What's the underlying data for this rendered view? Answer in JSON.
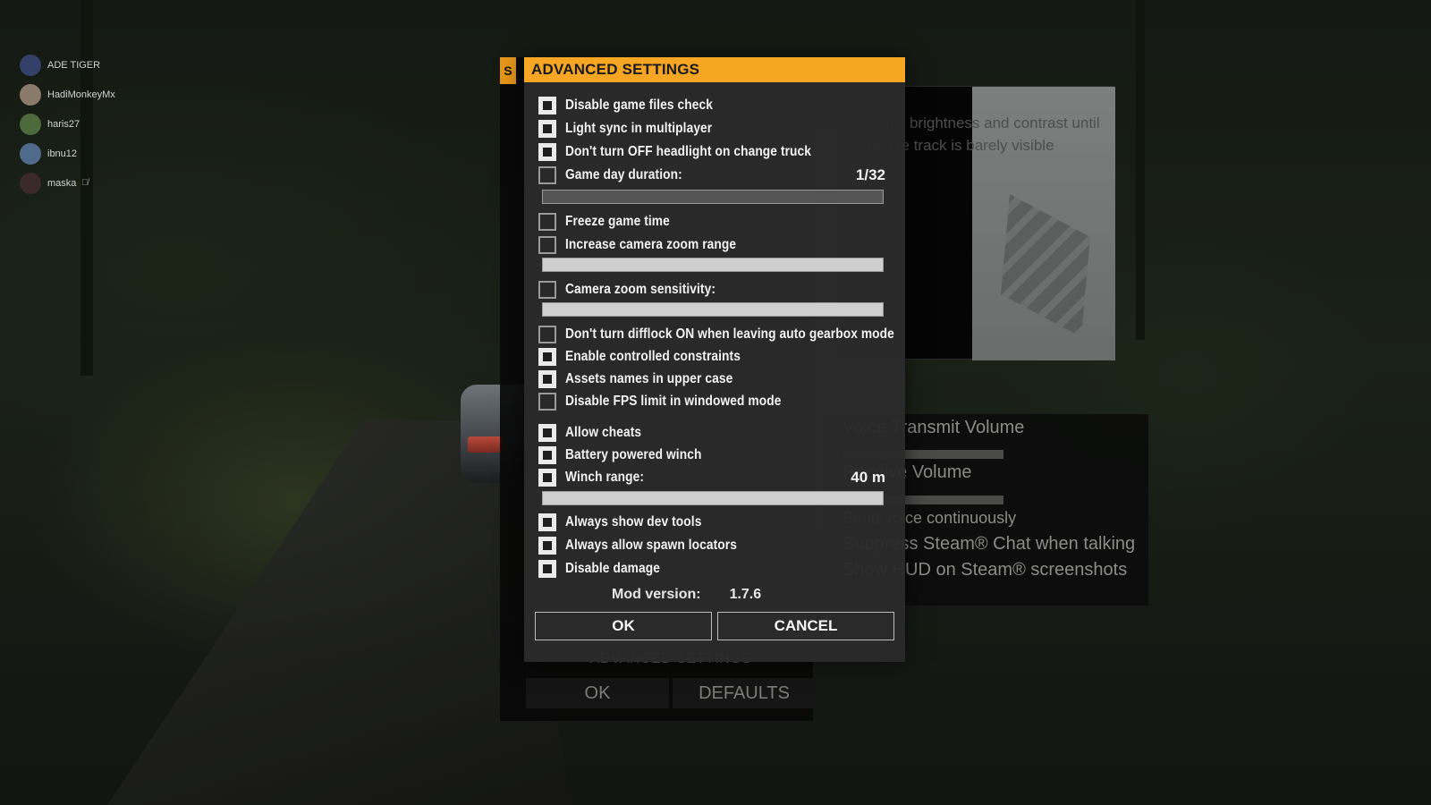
{
  "players": [
    {
      "name": "ADE TIGER"
    },
    {
      "name": "HadiMonkeyMx"
    },
    {
      "name": "haris27"
    },
    {
      "name": "ibnu12"
    },
    {
      "name": "maska",
      "muted": true
    }
  ],
  "background_window": {
    "tag": "S",
    "footer_title": "ADVANCED SETTINGS",
    "ok": "OK",
    "defaults": "DEFAULTS",
    "brightness_text": "Adjust brightness and contrast until the tire track is barely visible",
    "voice": {
      "transmit": "Voice Transmit Volume",
      "receive": "Receive Volume",
      "send_continuously": "Send voice continuously",
      "suppress_chat": "Suppress Steam® Chat when talking",
      "show_hud": "Show HUD on Steam® screenshots"
    }
  },
  "dialog": {
    "title": "ADVANCED SETTINGS",
    "options": {
      "disable_files_check": "Disable game files check",
      "light_sync": "Light sync in multiplayer",
      "headlight": "Don't turn OFF headlight on change truck",
      "day_duration": "Game day duration:",
      "day_duration_value": "1/32",
      "freeze_time": "Freeze game time",
      "zoom_range": "Increase camera zoom range",
      "zoom_sensitivity": "Camera zoom sensitivity:",
      "difflock": "Don't turn difflock ON when leaving auto gearbox mode",
      "constraints": "Enable controlled constraints",
      "upper_case": "Assets names in upper case",
      "fps_limit": "Disable FPS limit in windowed mode",
      "cheats": "Allow cheats",
      "battery_winch": "Battery powered winch",
      "winch_range": "Winch range:",
      "winch_range_value": "40 m",
      "dev_tools": "Always show dev tools",
      "spawn_locators": "Always allow spawn locators",
      "disable_damage": "Disable damage"
    },
    "mod_version_label": "Mod version:",
    "mod_version": "1.7.6",
    "ok": "OK",
    "cancel": "CANCEL"
  }
}
